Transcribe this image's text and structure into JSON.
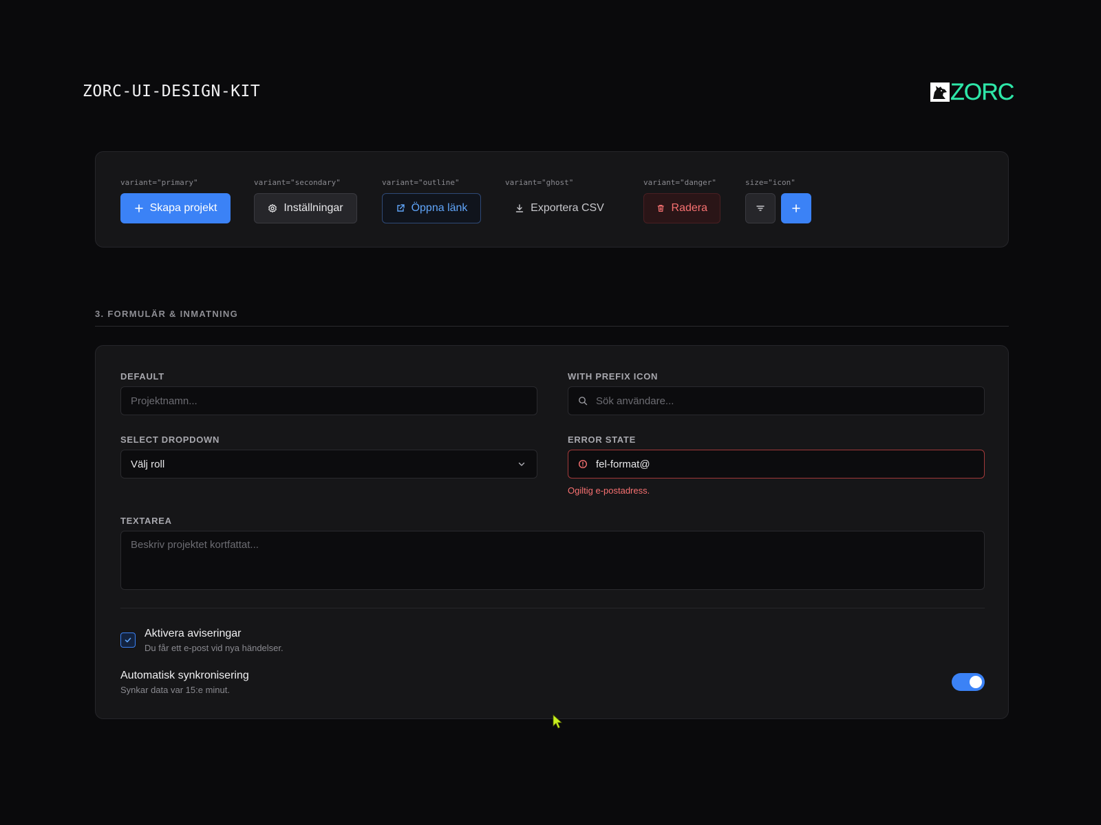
{
  "header": {
    "title": "ZORC-UI-DESIGN-KIT",
    "logo_text": "ZORC"
  },
  "buttons_showcase": {
    "groups": [
      {
        "label": "variant=\"primary\"",
        "button_label": "Skapa projekt",
        "icon": "plus-icon"
      },
      {
        "label": "variant=\"secondary\"",
        "button_label": "Inställningar",
        "icon": "gear-icon"
      },
      {
        "label": "variant=\"outline\"",
        "button_label": "Öppna länk",
        "icon": "external-link-icon"
      },
      {
        "label": "variant=\"ghost\"",
        "button_label": "Exportera CSV",
        "icon": "download-icon"
      },
      {
        "label": "variant=\"danger\"",
        "button_label": "Radera",
        "icon": "trash-icon"
      },
      {
        "label": "size=\"icon\"",
        "icons": [
          "filter-icon",
          "plus-icon"
        ]
      }
    ]
  },
  "form_section": {
    "heading": "3. FORMULÄR & INMATNING",
    "default_field": {
      "label": "DEFAULT",
      "placeholder": "Projektnamn..."
    },
    "prefix_field": {
      "label": "WITH PREFIX ICON",
      "placeholder": "Sök användare...",
      "icon": "search-icon"
    },
    "select_field": {
      "label": "SELECT DROPDOWN",
      "value": "Välj roll",
      "icon": "chevron-down-icon"
    },
    "error_field": {
      "label": "ERROR STATE",
      "value": "fel-format@",
      "error_message": "Ogiltig e-postadress.",
      "icon": "alert-circle-icon"
    },
    "textarea_field": {
      "label": "TEXTAREA",
      "placeholder": "Beskriv projektet kortfattat..."
    },
    "checkbox_option": {
      "title": "Aktivera aviseringar",
      "description": "Du får ett e-post vid nya händelser.",
      "checked": true
    },
    "toggle_option": {
      "title": "Automatisk synkronisering",
      "description": "Synkar data var 15:e minut.",
      "on": true
    }
  },
  "colors": {
    "background": "#0a0a0c",
    "card": "#161618",
    "primary": "#3b82f6",
    "danger": "#f87171",
    "logo": "#2ee6a8",
    "cursor": "#c8f020"
  }
}
